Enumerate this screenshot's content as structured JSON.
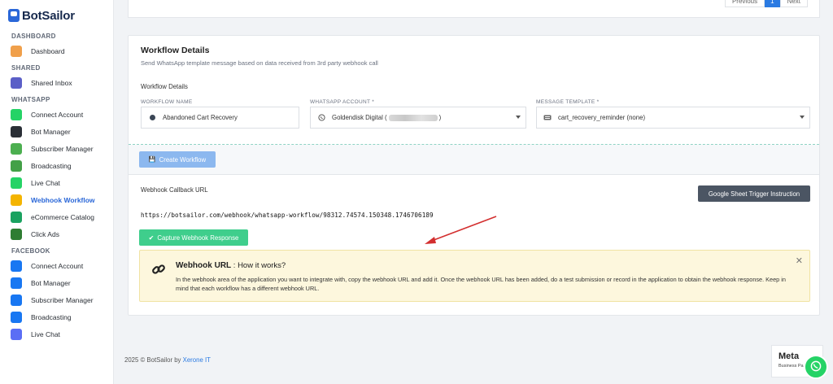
{
  "brand": {
    "name": "BotSailor"
  },
  "sidebar": {
    "sections": [
      {
        "title": "DASHBOARD",
        "items": [
          {
            "label": "Dashboard",
            "icon": "gauge-icon",
            "color": "#f0a04b"
          }
        ]
      },
      {
        "title": "SHARED",
        "items": [
          {
            "label": "Shared Inbox",
            "icon": "inbox-icon",
            "color": "#5b5fc7"
          }
        ]
      },
      {
        "title": "WHATSAPP",
        "items": [
          {
            "label": "Connect Account",
            "icon": "whatsapp-icon",
            "color": "#25d366"
          },
          {
            "label": "Bot Manager",
            "icon": "robot-icon",
            "color": "#2a2f36"
          },
          {
            "label": "Subscriber Manager",
            "icon": "users-icon",
            "color": "#4caf50"
          },
          {
            "label": "Broadcasting",
            "icon": "megaphone-icon",
            "color": "#43a047"
          },
          {
            "label": "Live Chat",
            "icon": "chat-icon",
            "color": "#25d366"
          },
          {
            "label": "Webhook Workflow",
            "icon": "webhook-icon",
            "color": "#f4b400",
            "active": true
          },
          {
            "label": "eCommerce Catalog",
            "icon": "bag-icon",
            "color": "#1aa260"
          },
          {
            "label": "Click Ads",
            "icon": "ads-icon",
            "color": "#2e7d32"
          }
        ]
      },
      {
        "title": "FACEBOOK",
        "items": [
          {
            "label": "Connect Account",
            "icon": "facebook-icon",
            "color": "#1877f2"
          },
          {
            "label": "Bot Manager",
            "icon": "robot-icon",
            "color": "#1877f2"
          },
          {
            "label": "Subscriber Manager",
            "icon": "users-icon",
            "color": "#1877f2"
          },
          {
            "label": "Broadcasting",
            "icon": "megaphone-icon",
            "color": "#1877f2"
          },
          {
            "label": "Live Chat",
            "icon": "messenger-icon",
            "color": "#5b6ef5"
          }
        ]
      }
    ]
  },
  "pager": {
    "prev": "Previous",
    "current": "1",
    "next": "Next"
  },
  "card": {
    "title": "Workflow Details",
    "subtitle": "Send WhatsApp template message based on data received from 3rd party webhook call",
    "details_label": "Workflow Details",
    "fields": {
      "name_label": "WORKFLOW NAME",
      "name_value": "Abandoned Cart Recovery",
      "account_label": "WHATSAPP ACCOUNT *",
      "account_value_prefix": "Goldendisk Digital (",
      "account_value_suffix": ")",
      "template_label": "MESSAGE TEMPLATE *",
      "template_value": "cart_recovery_reminder (none)"
    },
    "create_button": "Create Workflow",
    "callback_label": "Webhook Callback URL",
    "google_sheet_button": "Google Sheet Trigger Instruction",
    "callback_url": "https://botsailor.com/webhook/whatsapp-workflow/98312.74574.150348.1746706189",
    "capture_button": "Capture Webhook Response",
    "info": {
      "title_bold": "Webhook URL",
      "title_rest": " : How it works?",
      "text": "In the webhook area of the application you want to integrate with, copy the webhook URL and add it. Once the webhook URL has been added, do a test submission or record in the application to obtain the webhook response. Keep in mind that each workflow has a different webhook URL."
    }
  },
  "footer": {
    "copyright": "2025 © BotSailor by ",
    "company": "Xerone IT"
  },
  "meta_badge": {
    "title": "Meta",
    "subtitle": "Business Pa"
  },
  "colors": {
    "accent": "#2a67d8",
    "annotation_arrow": "#d32f2f",
    "create": "#8cb8ef",
    "capture": "#3fce8c"
  }
}
